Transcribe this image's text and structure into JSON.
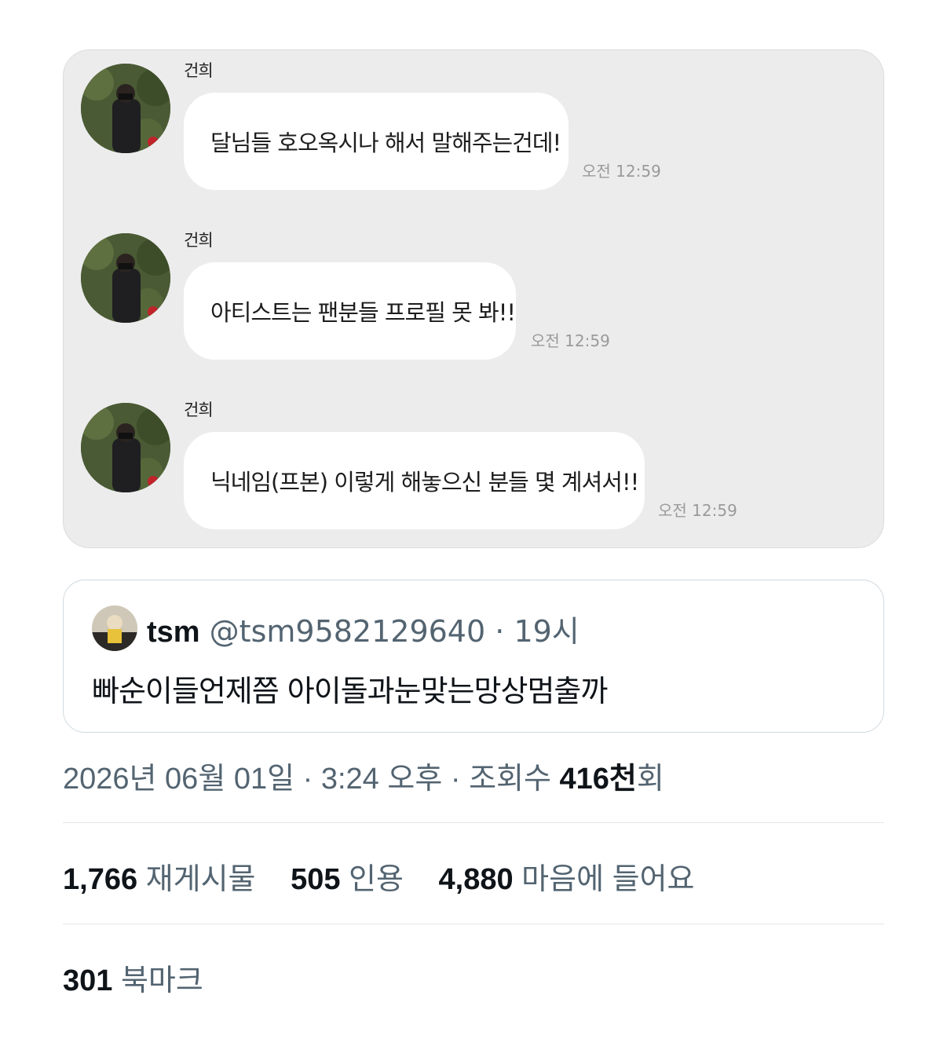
{
  "chat": {
    "messages": [
      {
        "sender": "건희",
        "text": "달님들 호오옥시나 해서 말해주는건데!",
        "time": "오전 12:59"
      },
      {
        "sender": "건희",
        "text": "아티스트는 팬분들 프로필 못 봐!!",
        "time": "오전 12:59"
      },
      {
        "sender": "건희",
        "text": "닉네임(프본) 이렇게 해놓으신 분들 몇 계셔서!!",
        "time": "오전 12:59"
      }
    ]
  },
  "quote": {
    "name": "tsm",
    "handle": "@tsm95821296​40",
    "separator": "·",
    "time": "19시",
    "text": "빠순이들언제쯤 아이돌과눈맞는망상멈출까"
  },
  "meta": {
    "date": "2026년 06월 01일",
    "sep1": "·",
    "clock": "3:24 오후",
    "sep2": "·",
    "views_label": "조회수",
    "views_num": "416천",
    "views_suffix": "회"
  },
  "stats": {
    "reposts_num": "1,766",
    "reposts_label": "재게시물",
    "quotes_num": "505",
    "quotes_label": "인용",
    "likes_num": "4,880",
    "likes_label": "마음에 들어요"
  },
  "bookmarks": {
    "num": "301",
    "label": "북마크"
  },
  "colors": {
    "secondary_text": "#536471",
    "chat_bg": "#ececec",
    "bubble": "#ffffff"
  }
}
